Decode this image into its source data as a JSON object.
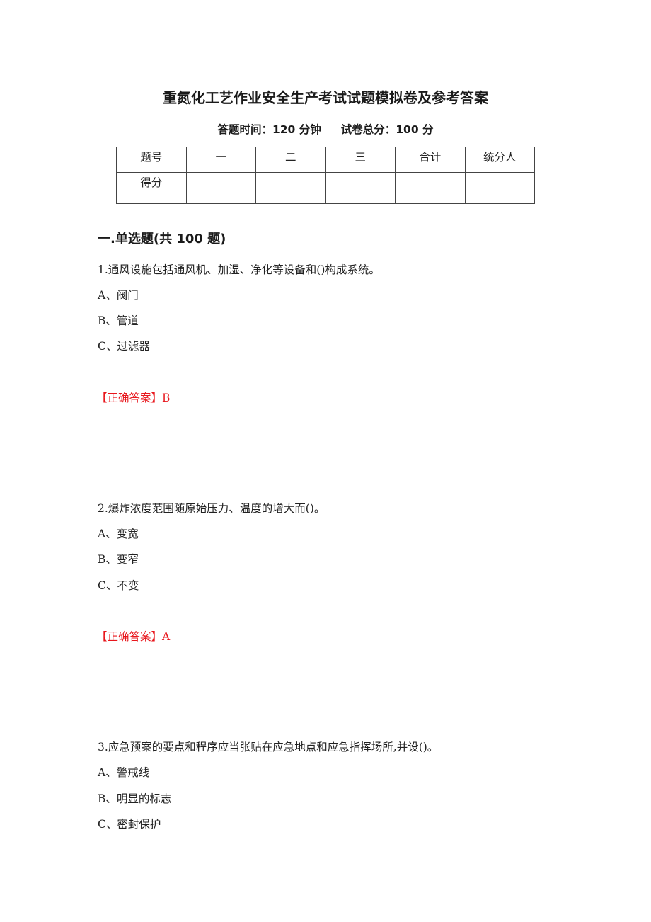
{
  "document": {
    "title": "重氮化工艺作业安全生产考试试题模拟卷及参考答案",
    "exam_time": "答题时间：120 分钟",
    "total_score": "试卷总分：100 分"
  },
  "score_table": {
    "header": [
      "题号",
      "一",
      "二",
      "三",
      "合计",
      "统分人"
    ],
    "row_label": "得分",
    "row_values": [
      "",
      "",
      "",
      "",
      ""
    ]
  },
  "section": {
    "title": "一.单选题(共 100 题)"
  },
  "questions": [
    {
      "text": "1.通风设施包括通风机、加湿、净化等设备和()构成系统。",
      "options": [
        "A、阀门",
        "B、管道",
        "C、过滤器"
      ],
      "answer": "【正确答案】B"
    },
    {
      "text": "2.爆炸浓度范围随原始压力、温度的增大而()。",
      "options": [
        "A、变宽",
        "B、变窄",
        "C、不变"
      ],
      "answer": "【正确答案】A"
    },
    {
      "text": "3.应急预案的要点和程序应当张贴在应急地点和应急指挥场所,并设()。",
      "options": [
        "A、警戒线",
        "B、明显的标志",
        "C、密封保护"
      ]
    }
  ],
  "colors": {
    "answer": "#e8161c",
    "text": "#222222"
  }
}
